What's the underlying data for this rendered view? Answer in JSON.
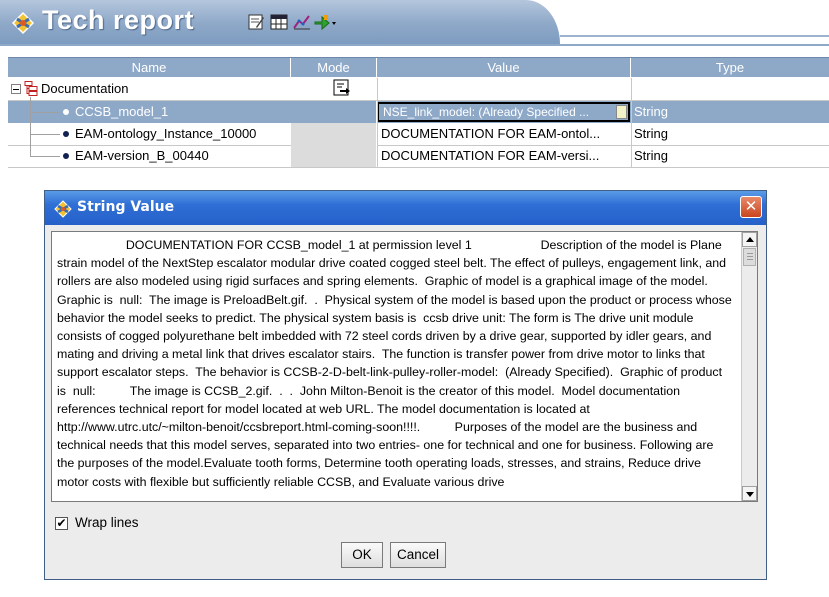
{
  "header": {
    "title": "Tech report",
    "icons": [
      "app-logo-icon",
      "edit-icon",
      "table-icon",
      "chart-icon",
      "export-icon",
      "dropdown-arrow-icon"
    ]
  },
  "table": {
    "columns": [
      "Name",
      "Mode",
      "Value",
      "Type"
    ],
    "root": {
      "name": "Documentation",
      "expanded": true
    },
    "rows": [
      {
        "name": "CCSB_model_1",
        "value": "NSE_link_model: (Already Specified ...",
        "type": "String",
        "selected": true
      },
      {
        "name": "EAM-ontology_Instance_10000",
        "value": "DOCUMENTATION FOR EAM-ontol...",
        "type": "String",
        "selected": false
      },
      {
        "name": "EAM-version_B_00440",
        "value": "DOCUMENTATION FOR EAM-versi...",
        "type": "String",
        "selected": false
      }
    ]
  },
  "dialog": {
    "title": "String Value",
    "text": "                    DOCUMENTATION FOR CCSB_model_1 at permission level 1                    Description of the model is Plane strain model of the NextStep escalator modular drive coated cogged steel belt. The effect of pulleys, engagement link, and rollers are also modeled using rigid surfaces and spring elements.  Graphic of model is a graphical image of the model. Graphic is  null:  The image is PreloadBelt.gif.  .  Physical system of the model is based upon the product or process whose behavior the model seeks to predict. The physical system basis is  ccsb drive unit: The form is The drive unit module consists of cogged polyurethane belt imbedded with 72 steel cords driven by a drive gear, supported by idler gears, and mating and driving a metal link that drives escalator stairs.  The function is transfer power from drive motor to links that support escalator steps.  The behavior is CCSB-2-D-belt-link-pulley-roller-model:  (Already Specified).  Graphic of product is  null:          The image is CCSB_2.gif.  .  .  John Milton-Benoit is the creator of this model.  Model documentation references technical report for model located at web URL. The model documentation is located at http://www.utrc.utc/~milton-benoit/ccsbreport.html-coming-soon!!!!.          Purposes of the model are the business and technical needs that this model serves, separated into two entries- one for technical and one for business. Following are the purposes of the model.Evaluate tooth forms, Determine tooth operating loads, stresses, and strains, Reduce drive motor costs with flexible but sufficiently reliable CCSB, and Evaluate various drive",
    "wrap_label": "Wrap lines",
    "wrap_checked": "✔",
    "ok_label": "OK",
    "cancel_label": "Cancel",
    "close_glyph": "✕"
  }
}
